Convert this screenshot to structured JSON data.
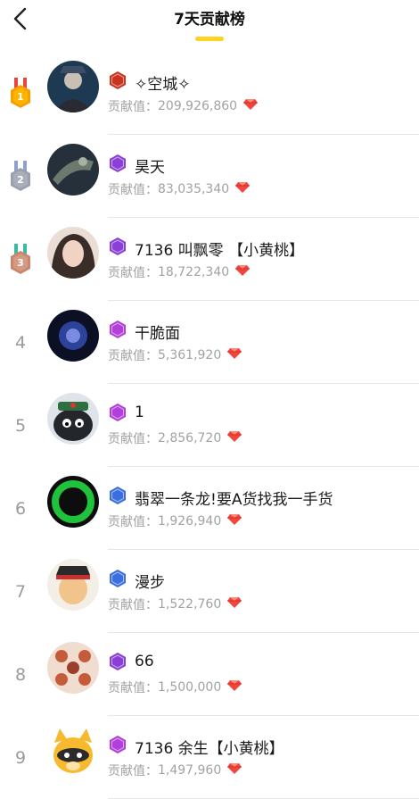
{
  "header": {
    "title": "7天贡献榜"
  },
  "contrib_label": "贡献值：",
  "colors": {
    "accent": "#ffd21f",
    "gem": "#f0463c"
  },
  "rows": [
    {
      "rank": "1",
      "medal": "gold",
      "badge_char": "王",
      "badge_color": "#c8341e",
      "name": "✧空城✧",
      "value": "209,926,860"
    },
    {
      "rank": "2",
      "medal": "silver",
      "badge_char": "公",
      "badge_color": "#8a3fd6",
      "name": "昊天",
      "value": "83,035,340"
    },
    {
      "rank": "3",
      "medal": "bronze",
      "badge_char": "公",
      "badge_color": "#8a3fd6",
      "name": "7136 叫飘零 【小黄桃】",
      "value": "18,722,340"
    },
    {
      "rank": "4",
      "medal": "",
      "badge_char": "侯",
      "badge_color": "#b23fd8",
      "name": "干脆面",
      "value": "5,361,920"
    },
    {
      "rank": "5",
      "medal": "",
      "badge_char": "侯",
      "badge_color": "#b23fd8",
      "name": "1",
      "value": "2,856,720"
    },
    {
      "rank": "6",
      "medal": "",
      "badge_char": "伯",
      "badge_color": "#3b6fe0",
      "name": "翡翠一条龙!要A货找我一手货",
      "value": "1,926,940"
    },
    {
      "rank": "7",
      "medal": "",
      "badge_char": "伯",
      "badge_color": "#3b6fe0",
      "name": "漫步",
      "value": "1,522,760"
    },
    {
      "rank": "8",
      "medal": "",
      "badge_char": "公",
      "badge_color": "#8a3fd6",
      "name": "66",
      "value": "1,500,000"
    },
    {
      "rank": "9",
      "medal": "",
      "badge_char": "侯",
      "badge_color": "#b23fd8",
      "name": "7136  余生【小黄桃】",
      "value": "1,497,960"
    }
  ]
}
